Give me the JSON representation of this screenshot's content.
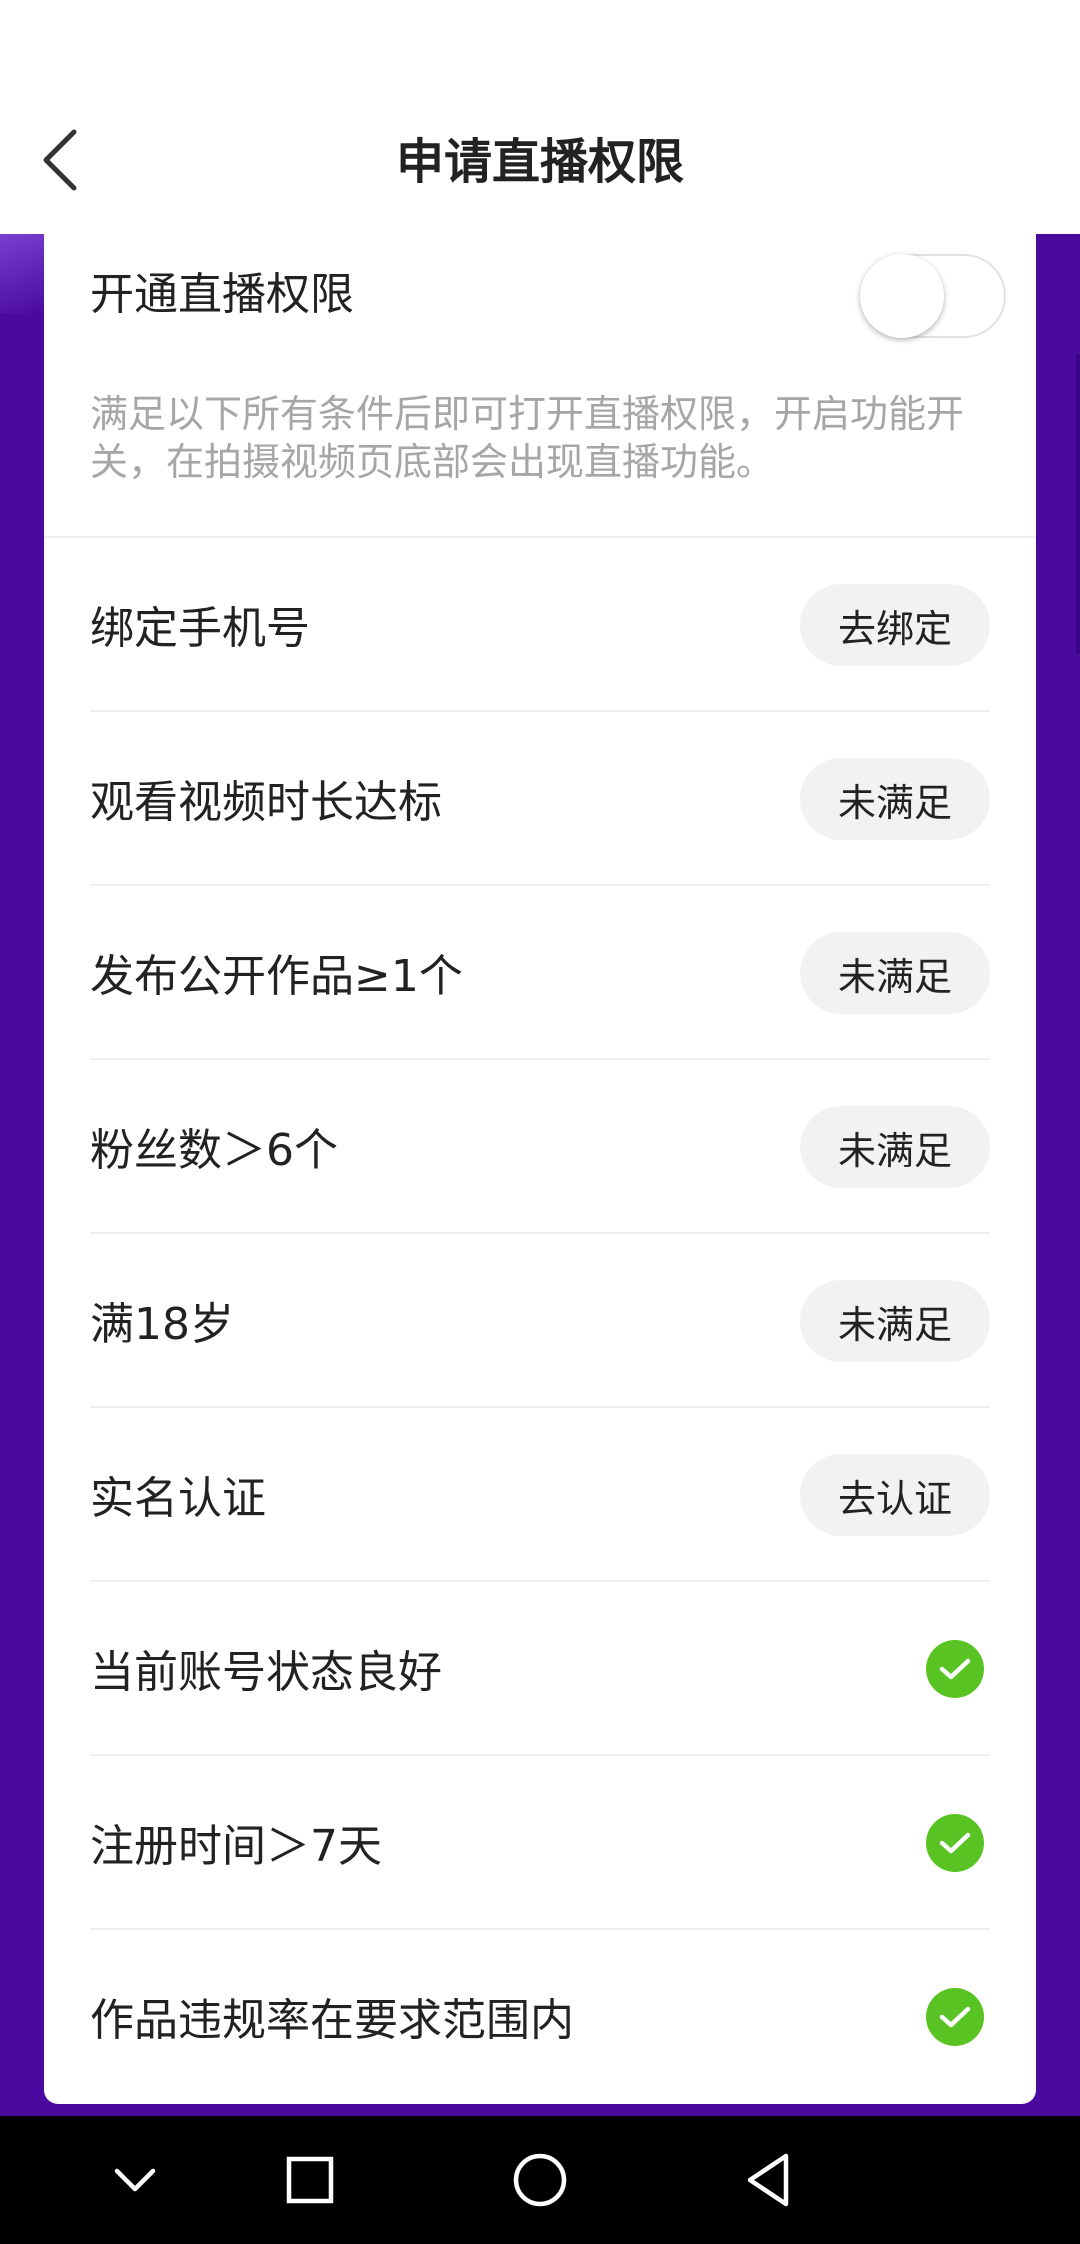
{
  "header": {
    "title": "申请直播权限",
    "back_icon": "chevron-left-icon"
  },
  "colors": {
    "accent_purple": "#4a0aa0",
    "check_green": "#58c322",
    "description_gray": "#a6a6a6"
  },
  "live_permission": {
    "toggle_label": "开通直播权限",
    "toggle_on": false,
    "description": "满足以下所有条件后即可打开直播权限，开启功能开关，在拍摄视频页底部会出现直播功能。"
  },
  "requirements": [
    {
      "label": "绑定手机号",
      "action": "去绑定",
      "met": false
    },
    {
      "label": "观看视频时长达标",
      "action": "未满足",
      "met": false
    },
    {
      "label": "发布公开作品≥1个",
      "action": "未满足",
      "met": false
    },
    {
      "label": "粉丝数＞6个",
      "action": "未满足",
      "met": false
    },
    {
      "label": "满18岁",
      "action": "未满足",
      "met": false
    },
    {
      "label": "实名认证",
      "action": "去认证",
      "met": false
    },
    {
      "label": "当前账号状态良好",
      "action": "",
      "met": true
    },
    {
      "label": "注册时间＞7天",
      "action": "",
      "met": true
    },
    {
      "label": "作品违规率在要求范围内",
      "action": "",
      "met": true
    }
  ],
  "nav_bar": {
    "icons": [
      "chevron-down-icon",
      "square-icon",
      "circle-icon",
      "triangle-back-icon"
    ]
  }
}
